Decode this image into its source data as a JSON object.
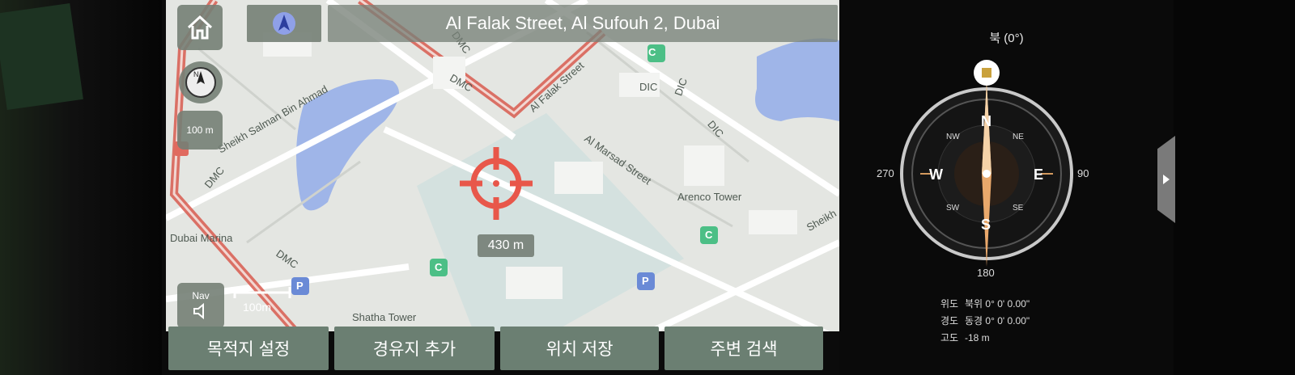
{
  "address": "Al Falak Street, Al Sufouh 2, Dubai",
  "scale_button": "100 m",
  "scale_bar": "100m",
  "nav_button": "Nav",
  "distance": "430 m",
  "bottom_buttons": [
    "목적지 설정",
    "경유지 추가",
    "위치 저장",
    "주변 검색"
  ],
  "map_labels": {
    "dmc1": "DMC",
    "dmc2": "DMC",
    "dmc3": "DMC",
    "dmc4": "DMC",
    "falak": "Al Falak Street",
    "marsad": "Al Marsad Street",
    "arenco": "Arenco Tower",
    "dubai_marina": "Dubai Marina",
    "shatha": "Shatha Tower",
    "dic1": "DIC",
    "dic2": "DIC",
    "dic3": "DIC",
    "salman": "Sheikh Salman Bin Ahmad",
    "sheikh": "Sheikh",
    "parking": "P",
    "c": "C"
  },
  "compass": {
    "heading": "북 (0°)",
    "n": "N",
    "s": "S",
    "e": "E",
    "w": "W",
    "nw": "NW",
    "ne": "NE",
    "sw": "SW",
    "se": "SE",
    "deg_90": "90",
    "deg_180": "180",
    "deg_270": "270"
  },
  "coords": {
    "lat_label": "위도",
    "lat_value": "북위 0° 0' 0.00\"",
    "lon_label": "경도",
    "lon_value": "동경 0° 0' 0.00\"",
    "alt_label": "고도",
    "alt_value": "-18 m"
  },
  "colors": {
    "map_bg": "#e4e6e2",
    "water": "#9fb5e8",
    "route": "#d85a4f",
    "button": "#6b7f72",
    "crosshair": "#e8574a",
    "compass_needle": "#e9a86b"
  }
}
